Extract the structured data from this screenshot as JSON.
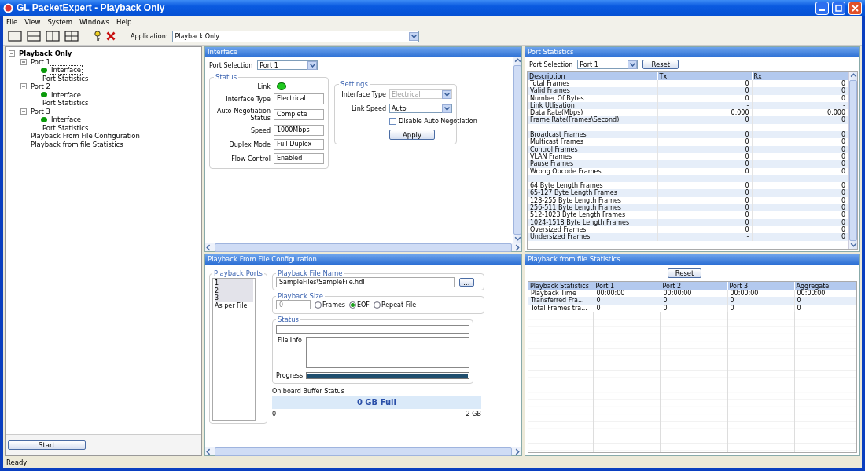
{
  "window": {
    "title": "GL PacketExpert - Playback Only"
  },
  "menu": [
    "File",
    "View",
    "System",
    "Windows",
    "Help"
  ],
  "toolbar": {
    "application_label": "Application:",
    "application_value": "Playback Only"
  },
  "tree": [
    {
      "label": "Playback Only",
      "expanded": true,
      "selected": false,
      "status_dot": false,
      "children": [
        {
          "label": "Port 1",
          "expanded": true,
          "selected": false,
          "status_dot": false,
          "children": [
            {
              "label": "Interface",
              "selected": true,
              "status_dot": true
            },
            {
              "label": "Port Statistics",
              "selected": false,
              "status_dot": false
            }
          ]
        },
        {
          "label": "Port 2",
          "expanded": true,
          "selected": false,
          "status_dot": false,
          "children": [
            {
              "label": "Interface",
              "selected": false,
              "status_dot": true
            },
            {
              "label": "Port Statistics",
              "selected": false,
              "status_dot": false
            }
          ]
        },
        {
          "label": "Port 3",
          "expanded": true,
          "selected": false,
          "status_dot": false,
          "children": [
            {
              "label": "Interface",
              "selected": false,
              "status_dot": true
            },
            {
              "label": "Port Statistics",
              "selected": false,
              "status_dot": false
            }
          ]
        },
        {
          "label": "Playback From File Configuration",
          "selected": false,
          "status_dot": false
        },
        {
          "label": "Playback from file Statistics",
          "selected": false,
          "status_dot": false
        }
      ]
    }
  ],
  "start_button": "Start",
  "interface": {
    "title": "Interface",
    "port_selection": {
      "label": "Port Selection",
      "value": "Port 1"
    },
    "status": {
      "title": "Status",
      "link_label": "Link",
      "link_up": true,
      "fields": [
        {
          "label": "Interface Type",
          "value": "Electrical"
        },
        {
          "label": "Auto-Negotiation Status",
          "value": "Complete"
        },
        {
          "label": "Speed",
          "value": "1000Mbps"
        },
        {
          "label": "Duplex Mode",
          "value": "Full Duplex"
        },
        {
          "label": "Flow Control",
          "value": "Enabled"
        }
      ]
    },
    "settings": {
      "title": "Settings",
      "interface_type": {
        "label": "Interface Type",
        "value": "Electrical",
        "disabled": true
      },
      "link_speed": {
        "label": "Link Speed",
        "value": "Auto",
        "disabled": false
      },
      "disable_auto_negotiation": {
        "label": "Disable Auto Negotiation",
        "checked": false
      },
      "apply": "Apply"
    }
  },
  "port_statistics": {
    "title": "Port Statistics",
    "port_selection": {
      "label": "Port Selection",
      "value": "Port 1"
    },
    "reset": "Reset",
    "columns": [
      "Description",
      "Tx",
      "Rx"
    ],
    "rows": [
      {
        "kind": "data",
        "cells": [
          "Total Frames",
          "0",
          "0"
        ]
      },
      {
        "kind": "data",
        "cells": [
          "Valid Frames",
          "0",
          "0"
        ]
      },
      {
        "kind": "data",
        "cells": [
          "Number Of Bytes",
          "0",
          "0"
        ]
      },
      {
        "kind": "data",
        "cells": [
          "Link Utlisation",
          "-",
          "-"
        ]
      },
      {
        "kind": "data",
        "cells": [
          "Data Rate(Mbps)",
          "0.000",
          "0.000"
        ]
      },
      {
        "kind": "data",
        "cells": [
          "Frame Rate(Frames\\Second)",
          "0",
          "0"
        ]
      },
      {
        "kind": "spacer"
      },
      {
        "kind": "data",
        "cells": [
          "Broadcast Frames",
          "0",
          "0"
        ]
      },
      {
        "kind": "data",
        "cells": [
          "Multicast Frames",
          "0",
          "0"
        ]
      },
      {
        "kind": "data",
        "cells": [
          "Control Frames",
          "0",
          "0"
        ]
      },
      {
        "kind": "data",
        "cells": [
          "VLAN Frames",
          "0",
          "0"
        ]
      },
      {
        "kind": "data",
        "cells": [
          "Pause Frames",
          "0",
          "0"
        ]
      },
      {
        "kind": "data",
        "cells": [
          "Wrong Opcode Frames",
          "0",
          "0"
        ]
      },
      {
        "kind": "spacer"
      },
      {
        "kind": "data",
        "cells": [
          "64 Byte Length Frames",
          "0",
          "0"
        ]
      },
      {
        "kind": "data",
        "cells": [
          "65-127 Byte Length Frames",
          "0",
          "0"
        ]
      },
      {
        "kind": "data",
        "cells": [
          "128-255 Byte Length Frames",
          "0",
          "0"
        ]
      },
      {
        "kind": "data",
        "cells": [
          "256-511 Byte Length Frames",
          "0",
          "0"
        ]
      },
      {
        "kind": "data",
        "cells": [
          "512-1023 Byte Length Frames",
          "0",
          "0"
        ]
      },
      {
        "kind": "data",
        "cells": [
          "1024-1518 Byte Length Frames",
          "0",
          "0"
        ]
      },
      {
        "kind": "data",
        "cells": [
          "Oversized Frames",
          "0",
          "0"
        ]
      },
      {
        "kind": "data",
        "cells": [
          "Undersized Frames",
          "-",
          "0"
        ]
      }
    ]
  },
  "playback_config": {
    "title": "Playback From File Configuration",
    "ports": {
      "title": "Playback Ports",
      "items": [
        {
          "label": "1",
          "selected": true
        },
        {
          "label": "2",
          "selected": true
        },
        {
          "label": "3",
          "selected": true
        },
        {
          "label": "As per File",
          "selected": false
        }
      ]
    },
    "file_name": {
      "title": "Playback File Name",
      "value": "SampleFiles\\SampleFile.hdl",
      "browse": "..."
    },
    "playback_size": {
      "title": "Playback Size",
      "placeholder": "0",
      "options": [
        {
          "label": "Frames",
          "selected": false
        },
        {
          "label": "EOF",
          "selected": true
        },
        {
          "label": "Repeat File",
          "selected": false
        }
      ]
    },
    "status": {
      "title": "Status",
      "file_info_label": "File Info",
      "progress_label": "Progress",
      "progress": {
        "level": 1
      }
    },
    "buffer": {
      "label": "On board Buffer Status",
      "value": "0 GB Full",
      "min": "0",
      "max": "2 GB"
    }
  },
  "playback_stats": {
    "title": "Playback from file Statistics",
    "reset": "Reset",
    "columns": [
      "Playback Statistics",
      "Port 1",
      "Port 2",
      "Port 3",
      "Aggregate"
    ],
    "rows": [
      [
        "Playback Time",
        "00:00:00",
        "00:00:00",
        "00:00:00",
        "00:00:00"
      ],
      [
        "Transferred Fra...",
        "0",
        "0",
        "0",
        "0"
      ],
      [
        "Total Frames tra...",
        "0",
        "0",
        "0",
        "0"
      ]
    ]
  },
  "status_bar": "Ready"
}
